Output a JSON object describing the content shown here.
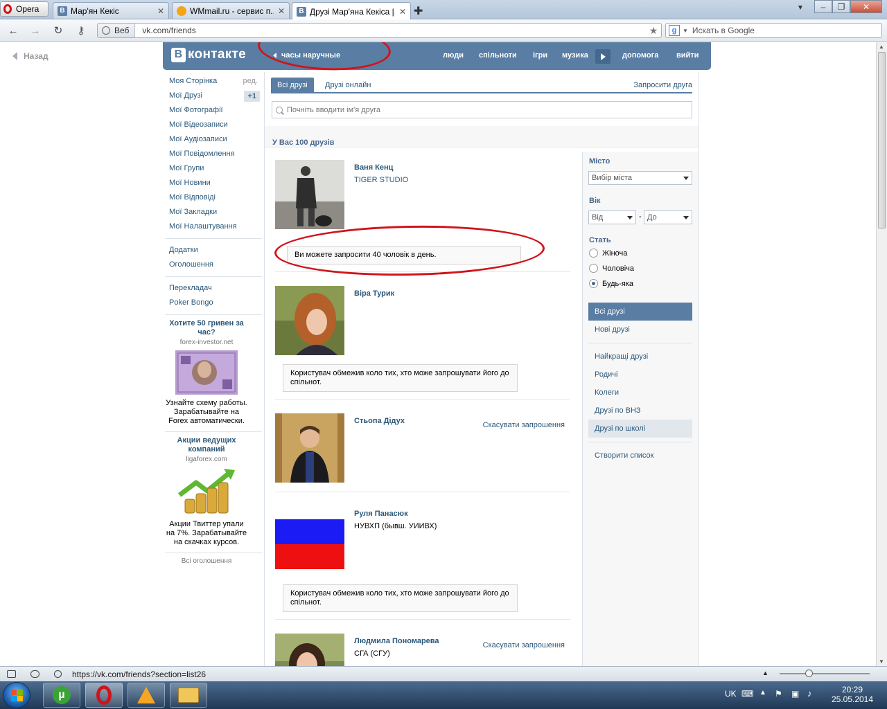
{
  "browser": {
    "menu_label": "Opera",
    "tabs": [
      {
        "title": "Мар'ян Кекіс",
        "favicon": "vk-icon"
      },
      {
        "title": "WMmail.ru - сервис п...",
        "favicon": "wmmail-icon"
      },
      {
        "title": "Друзі Мар'яна Кекіса |...",
        "favicon": "vk-icon"
      }
    ],
    "address_scheme": "Веб",
    "address_url": "vk.com/friends",
    "search_placeholder": "Искать в Google",
    "status_url": "https://vk.com/friends?section=list26"
  },
  "page": {
    "back_label": "Назад",
    "vk": {
      "logo_text": "контакте",
      "logo_letter": "В",
      "status_text": "часы наручные",
      "nav": [
        "люди",
        "спільноти",
        "ігри",
        "музика",
        "допомога",
        "вийти"
      ]
    },
    "left_menu": {
      "items": [
        {
          "label": "Моя Сторінка",
          "side": "ред."
        },
        {
          "label": "Мої Друзі",
          "badge": "+1"
        },
        {
          "label": "Мої Фотографії"
        },
        {
          "label": "Мої Відеозаписи"
        },
        {
          "label": "Мої Аудіозаписи"
        },
        {
          "label": "Мої Повідомлення"
        },
        {
          "label": "Мої Групи"
        },
        {
          "label": "Мої Новини"
        },
        {
          "label": "Мої Відповіді"
        },
        {
          "label": "Мої Закладки"
        },
        {
          "label": "Мої Налаштування"
        }
      ],
      "extra": [
        "Додатки",
        "Оголошення"
      ],
      "extra2": [
        "Перекладач",
        "Poker Bongo"
      ]
    },
    "ads": [
      {
        "title": "Хотите 50 гривен за час?",
        "domain": "forex-investor.net",
        "text": "Узнайте схему работы. Зарабатывайте на Forex автоматически."
      },
      {
        "title": "Акции ведущих компаний",
        "domain": "ligaforex.com",
        "text": "Акции Твиттер упали на 7%. Зарабатывайте на скачках курсов."
      }
    ],
    "all_ads_label": "Всі оголошення",
    "friends": {
      "tabs": [
        "Всі друзі",
        "Друзі онлайн"
      ],
      "invite_label": "Запросити друга",
      "search_placeholder": "Почніть вводити ім'я друга",
      "count_label": "У Вас 100 друзів",
      "list": [
        {
          "name": "Ваня Кенц",
          "sub": "TIGER STUDIO",
          "note": "Ви можете запросити 40 чоловік в день."
        },
        {
          "name": "Віра Турик",
          "note": "Користувач обмежив коло тих, хто може запрошувати його до спільнот."
        },
        {
          "name": "Стьопа Дідух",
          "cancel": "Скасувати запрошення"
        },
        {
          "name": "Руля Панасюк",
          "sub": "НУВХП (бывш. УИИВХ)",
          "note": "Користувач обмежив коло тих, хто може запрошувати його до спільнот."
        },
        {
          "name": "Людмила Пономарева",
          "sub": "СГА (СГУ)",
          "cancel": "Скасувати запрошення"
        }
      ]
    },
    "filters": {
      "city_head": "Місто",
      "city_select": "Вибір міста",
      "age_head": "Вік",
      "age_from": "Від",
      "age_dash": "-",
      "age_to": "До",
      "sex_head": "Стать",
      "sex_options": [
        "Жіноча",
        "Чоловіча",
        "Будь-яка"
      ],
      "sex_selected": "Будь-яка",
      "lists_a": [
        "Всі друзі",
        "Нові друзі"
      ],
      "lists_b": [
        "Найкращі друзі",
        "Родичі",
        "Колеги",
        "Друзі по ВНЗ",
        "Друзі по школі"
      ],
      "create_list": "Створити список"
    }
  },
  "taskbar": {
    "lang": "UK",
    "time": "20:29",
    "date": "25.05.2014"
  },
  "colors": {
    "vk_blue": "#597da3",
    "link": "#2b587a",
    "annotation_red": "#d0141a"
  }
}
